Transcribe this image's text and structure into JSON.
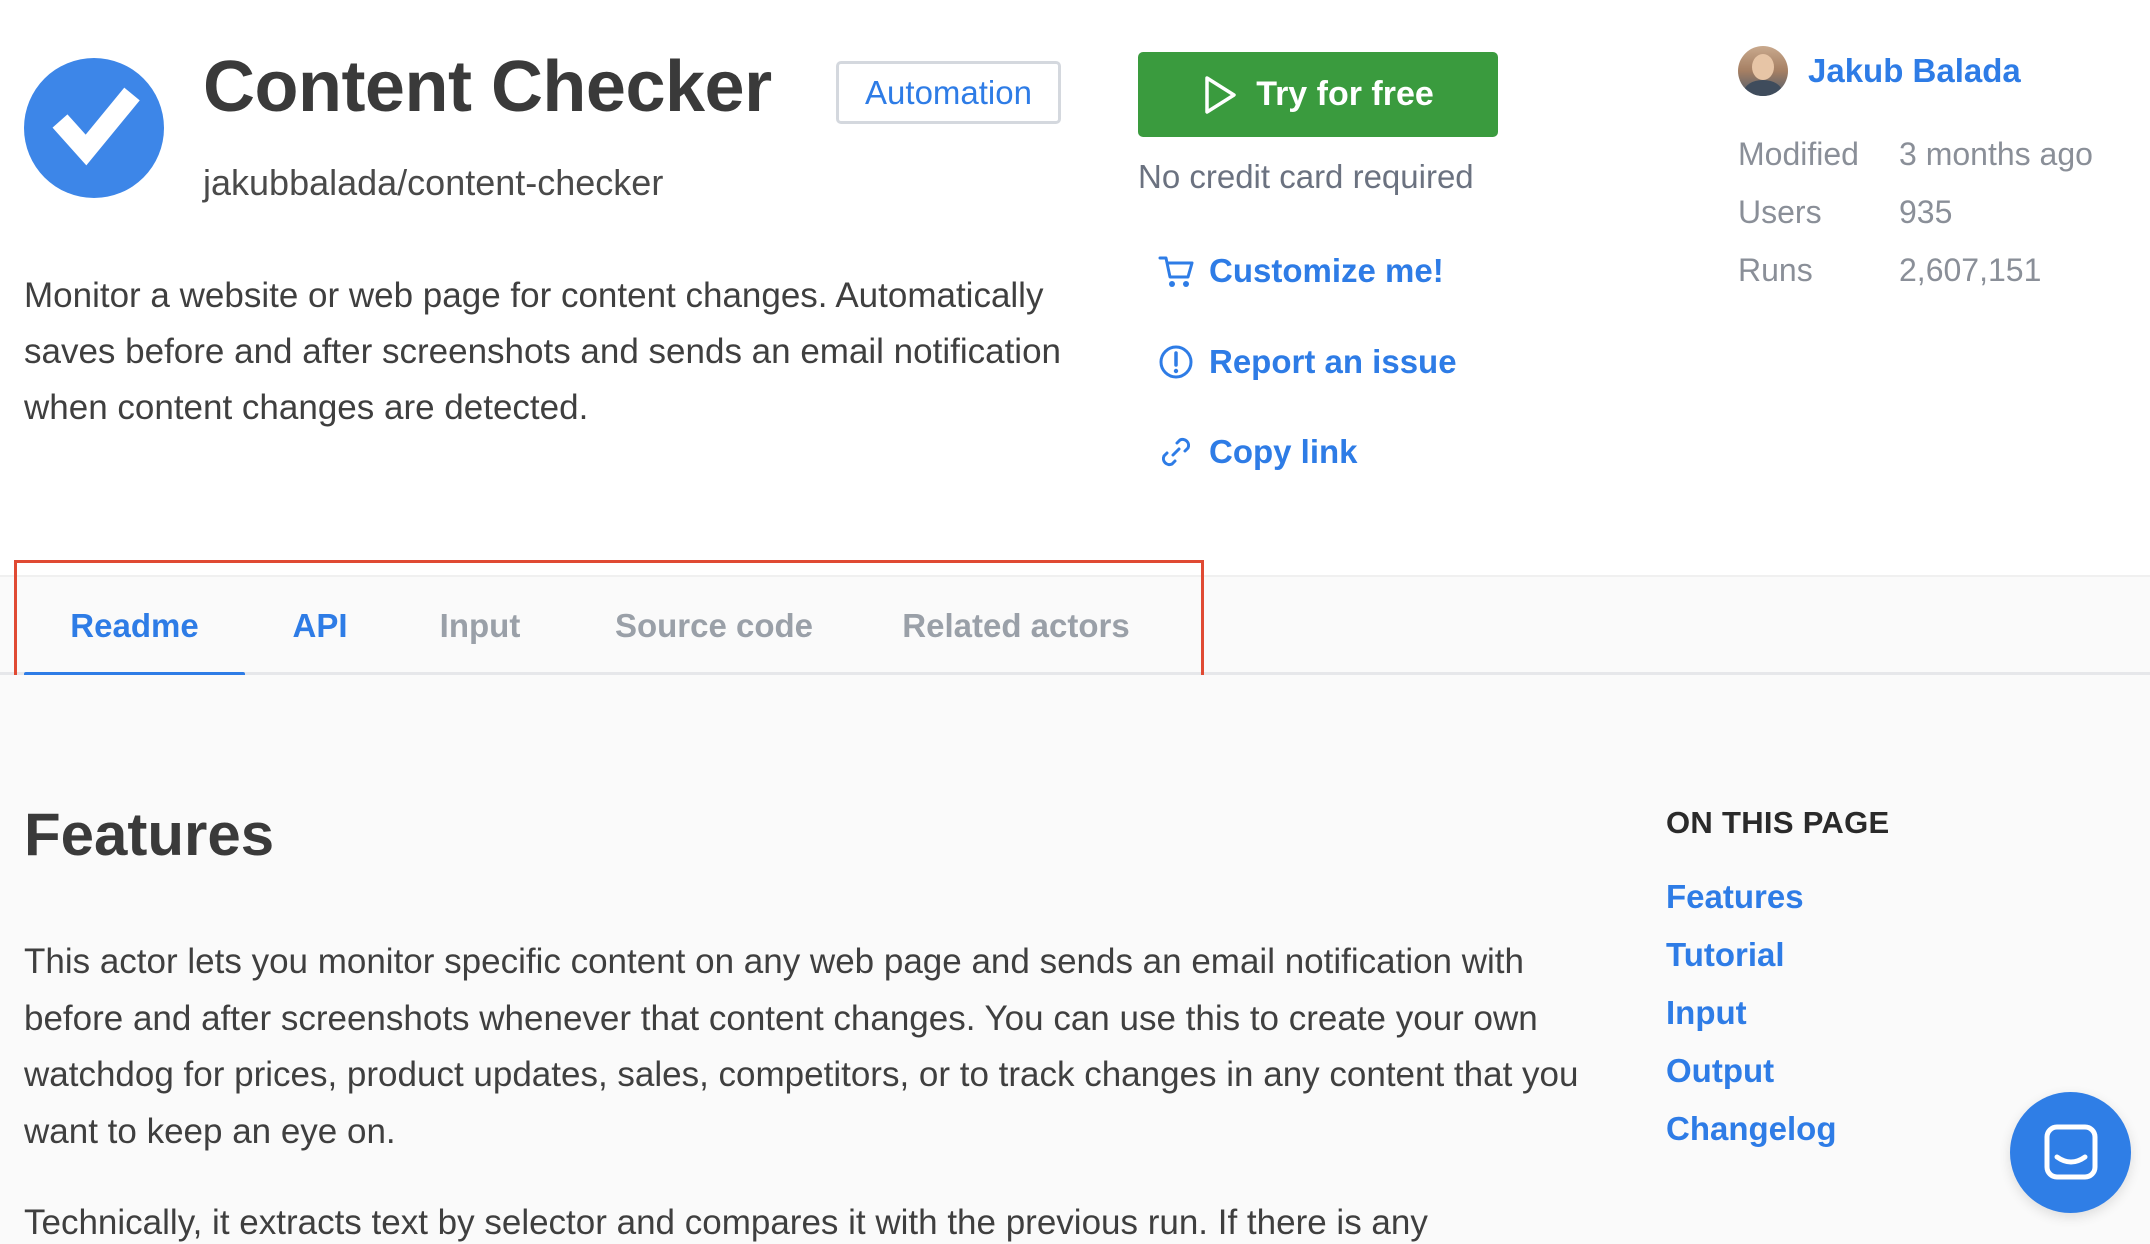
{
  "header": {
    "title": "Content Checker",
    "category_badge": "Automation",
    "slug": "jakubbalada/content-checker",
    "description": "Monitor a website or web page for content changes. Automatically saves before and after screenshots and sends an email notification when content changes are detected."
  },
  "cta": {
    "try_label": "Try for free",
    "no_credit_card": "No credit card required"
  },
  "actions": [
    {
      "label": "Customize me!",
      "icon": "cart-icon"
    },
    {
      "label": "Report an issue",
      "icon": "exclamation-circle-icon"
    },
    {
      "label": "Copy link",
      "icon": "link-icon"
    }
  ],
  "author": {
    "name": "Jakub Balada"
  },
  "stats": [
    {
      "label": "Modified",
      "value": "3 months ago"
    },
    {
      "label": "Users",
      "value": "935"
    },
    {
      "label": "Runs",
      "value": "2,607,151"
    }
  ],
  "tabs": [
    {
      "label": "Readme",
      "active": true
    },
    {
      "label": "API",
      "active": false
    },
    {
      "label": "Input",
      "active": false
    },
    {
      "label": "Source code",
      "active": false
    },
    {
      "label": "Related actors",
      "active": false
    }
  ],
  "readme": {
    "heading": "Features",
    "paragraph1": "This actor lets you monitor specific content on any web page and sends an email notification with before and after screenshots whenever that content changes. You can use this to create your own watchdog for prices, product updates, sales, competitors, or to track changes in any content that you want to keep an eye on.",
    "paragraph2": "Technically, it extracts text by selector and compares it with the previous run. If there is any"
  },
  "toc": {
    "title": "ON THIS PAGE",
    "links": [
      "Features",
      "Tutorial",
      "Input",
      "Output",
      "Changelog"
    ]
  },
  "colors": {
    "accent": "#2e7ce6",
    "try_button": "#3a9b3e",
    "highlight_box": "#e04a33"
  }
}
